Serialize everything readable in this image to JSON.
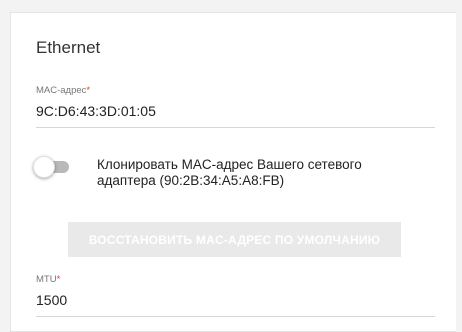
{
  "section": {
    "title": "Ethernet"
  },
  "mac_field": {
    "label": "MAC-адрес",
    "required_mark": "*",
    "value": "9C:D6:43:3D:01:05"
  },
  "clone_toggle": {
    "label": "Клонировать MAC-адрес Вашего сетевого адаптера (90:2B:34:A5:A8:FB)",
    "state": "off"
  },
  "restore_button": {
    "label": "ВОССТАНОВИТЬ MAC-АДРЕС ПО УМОЛЧАНИЮ",
    "state": "disabled"
  },
  "mtu_field": {
    "label": "MTU",
    "required_mark": "*",
    "value": "1500"
  },
  "colors": {
    "required": "#e53935",
    "toggle_track_off": "#b9b9b9",
    "button_disabled_bg": "#e9e9e9"
  }
}
